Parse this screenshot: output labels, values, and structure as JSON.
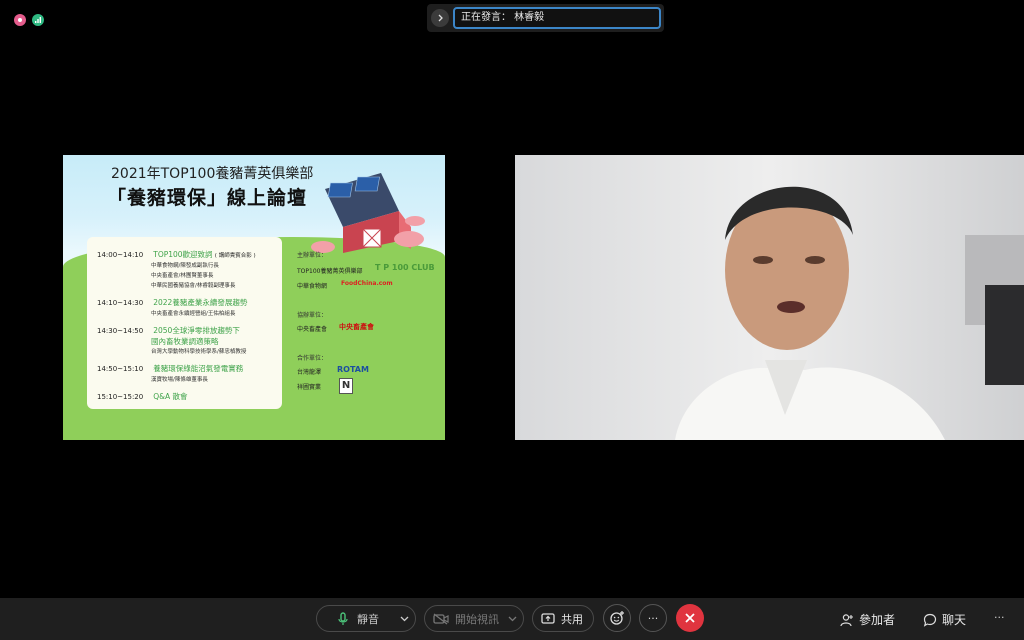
{
  "speaker": {
    "text": "正在發言： 林睿毅"
  },
  "slide": {
    "title1": "2021年TOP100養豬菁英俱樂部",
    "title2": "「養豬環保」線上論壇",
    "agenda": [
      {
        "time": "14:00~14:10",
        "title": "TOP100歡迎致詞",
        "note": "( 講師貴賓合影 )",
        "subs": [
          "中華食物網/陳發成副執行長",
          "中央畜產會/林團賢董事長",
          "中華民國養豬協會/林睿毅副理事長"
        ]
      },
      {
        "time": "14:10~14:30",
        "title": "2022養豬產業永續發展趨勢",
        "subs": [
          "中央畜產會永續經營組/王佑柏組長"
        ]
      },
      {
        "time": "14:30~14:50",
        "title": "2050全球淨零排放趨勢下",
        "title2": "國內畜牧業調適策略",
        "subs": [
          "台灣大學動物科學技術學系/蘇忠楨教授"
        ]
      },
      {
        "time": "14:50~15:10",
        "title": "養豬環保綠能沼氣發電實務",
        "subs": [
          "漢寶牧場/陳條雄董事長"
        ]
      },
      {
        "time": "15:10~15:20",
        "title": "Q&A  散會",
        "subs": []
      }
    ],
    "orgs": {
      "host_head": "主辦單位：",
      "host1": "TOP100養豬菁英俱樂部",
      "host1_logo": "T P 100 CLUB",
      "host2": "中華食物網",
      "host2_logo": "FoodChina.com",
      "co_head": "協辦單位：",
      "co1": "中央畜產會",
      "co1_logo": "中央畜產會",
      "partner_head": "合作單位：",
      "partner1": "台灣龍澤",
      "partner1_logo": "ROTAM",
      "partner2": "祥圃實業",
      "partner2_logo": "N"
    }
  },
  "toolbar": {
    "mute_label": "靜音",
    "video_label": "開始視訊",
    "share_label": "共用",
    "more_label": "···",
    "participants_label": "參加者",
    "chat_label": "聊天",
    "overflow_label": "···"
  },
  "colors": {
    "accent": "#3c86c8",
    "end": "#e0343f",
    "agenda_title": "#3fa34a"
  }
}
